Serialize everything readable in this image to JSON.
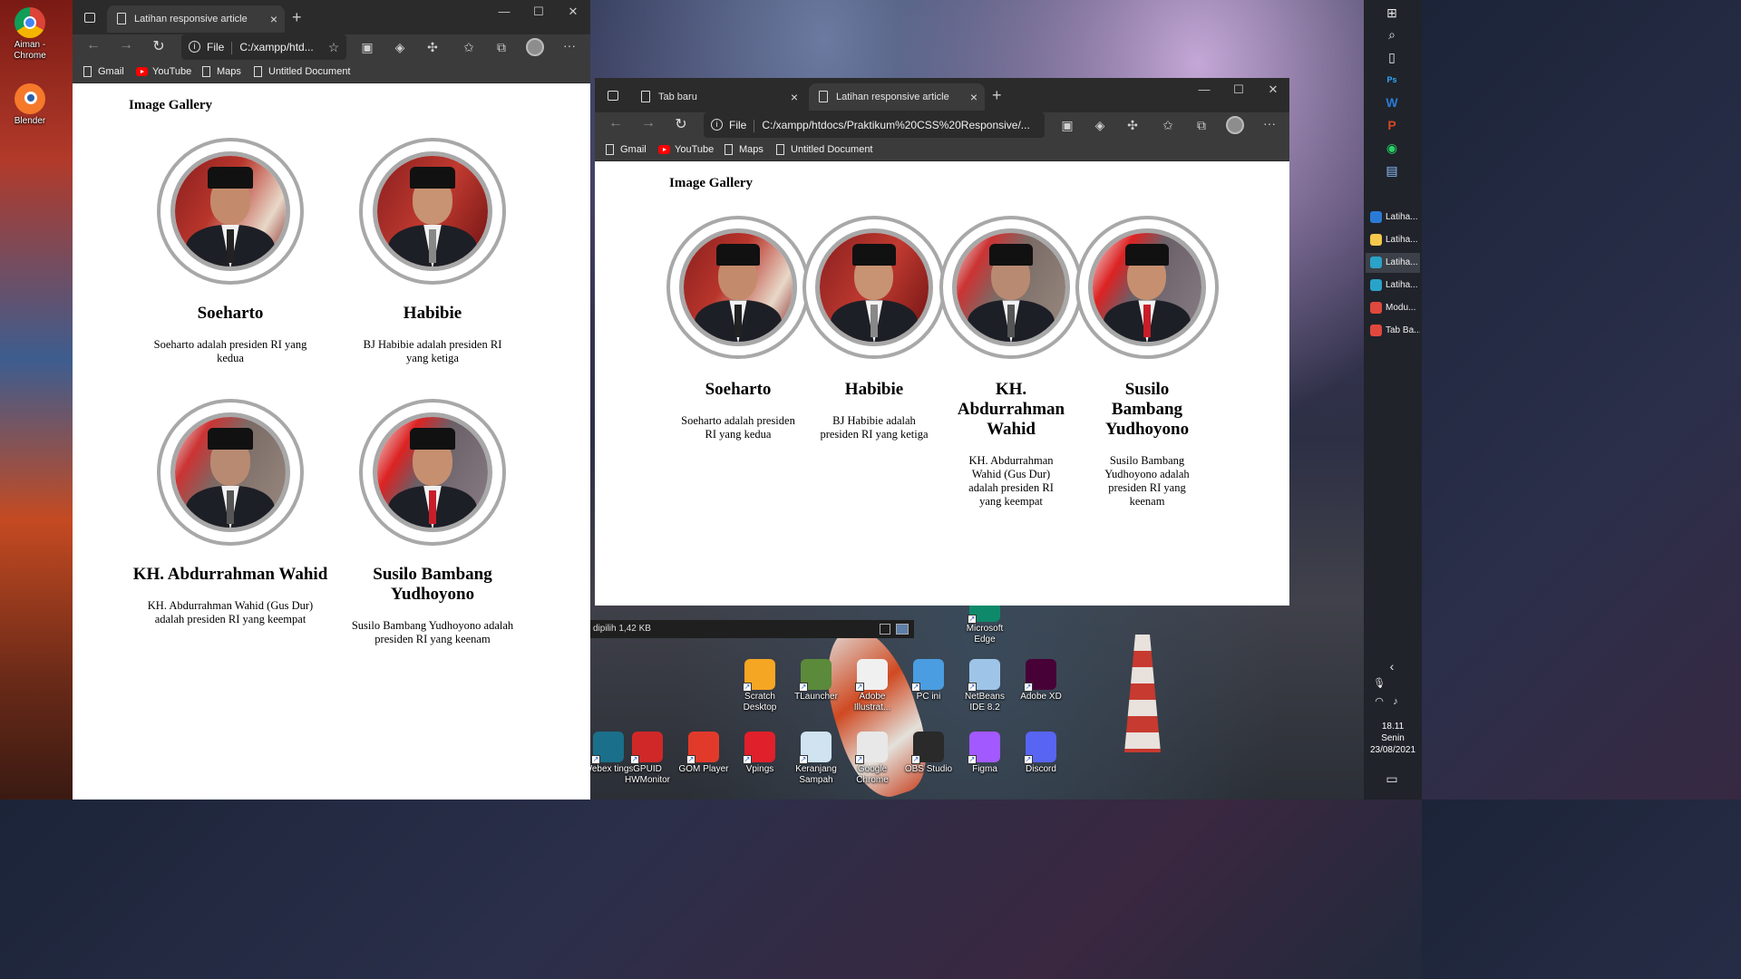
{
  "desktop_left": {
    "icons": [
      {
        "label": "Aiman - Chrome",
        "icon": "chrome-icon"
      },
      {
        "label": "Blender",
        "icon": "blender-icon"
      }
    ]
  },
  "desktop_right": {
    "icons": [
      {
        "label": "Microsoft Edge",
        "icon": "edge-icon"
      },
      {
        "label": "Scratch Desktop",
        "icon": "scratch-icon"
      },
      {
        "label": "TLauncher",
        "icon": "tlauncher-icon"
      },
      {
        "label": "Adobe Illustrat...",
        "icon": "illustrator-icon"
      },
      {
        "label": "PC ini",
        "icon": "pc-icon"
      },
      {
        "label": "NetBeans IDE 8.2",
        "icon": "netbeans-icon"
      },
      {
        "label": "Adobe XD",
        "icon": "xd-icon"
      },
      {
        "label": "Webex tings",
        "icon": "webex-icon"
      },
      {
        "label": "GPUID HWMonitor",
        "icon": "hwmonitor-icon"
      },
      {
        "label": "GOM Player",
        "icon": "gom-icon"
      },
      {
        "label": "Vpings",
        "icon": "vpings-icon"
      },
      {
        "label": "Keranjang Sampah",
        "icon": "recycle-bin-icon"
      },
      {
        "label": "Google Chrome",
        "icon": "chrome-icon"
      },
      {
        "label": "OBS Studio",
        "icon": "obs-icon"
      },
      {
        "label": "Figma",
        "icon": "figma-icon"
      },
      {
        "label": "Discord",
        "icon": "discord-icon"
      }
    ]
  },
  "explorer_status": {
    "text": "dipilih  1,42 KB"
  },
  "taskbar": {
    "tasks": [
      {
        "label": "Latiha...",
        "color": "#2b7bd6"
      },
      {
        "label": "Latiha...",
        "color": "#f3c84b"
      },
      {
        "label": "Latiha...",
        "color": "#2aa3c9"
      },
      {
        "label": "Latiha...",
        "color": "#2aa3c9"
      },
      {
        "label": "Modu...",
        "color": "#e0483d"
      },
      {
        "label": "Tab Ba...",
        "color": "#e0483d"
      }
    ],
    "clock_time": "18.11",
    "clock_day": "Senin",
    "clock_date": "23/08/2021"
  },
  "window1": {
    "tab_title": "Latihan responsive article",
    "address": "C:/xampp/htd...",
    "file_label": "File",
    "bookmarks": [
      "Gmail",
      "YouTube",
      "Maps",
      "Untitled Document"
    ],
    "page": {
      "title": "Image Gallery",
      "cards": [
        {
          "name": "Soeharto",
          "desc": "Soeharto adalah presiden RI yang kedua"
        },
        {
          "name": "Habibie",
          "desc": "BJ Habibie adalah presiden RI yang ketiga"
        },
        {
          "name": "KH. Abdurrahman Wahid",
          "desc": "KH. Abdurrahman Wahid (Gus Dur) adalah presiden RI yang keempat"
        },
        {
          "name": "Susilo Bambang Yudhoyono",
          "desc": "Susilo Bambang Yudhoyono adalah presiden RI yang keenam"
        }
      ]
    }
  },
  "window2": {
    "tabs": [
      "Tab baru",
      "Latihan responsive article"
    ],
    "address": "C:/xampp/htdocs/Praktikum%20CSS%20Responsive/...",
    "file_label": "File",
    "bookmarks": [
      "Gmail",
      "YouTube",
      "Maps",
      "Untitled Document"
    ],
    "page": {
      "title": "Image Gallery",
      "cards": [
        {
          "name": "Soeharto",
          "desc": "Soeharto adalah presiden RI yang kedua"
        },
        {
          "name": "Habibie",
          "desc": "BJ Habibie adalah presiden RI yang ketiga"
        },
        {
          "name": "KH. Abdurrahman Wahid",
          "desc": "KH. Abdurrahman Wahid (Gus Dur) adalah presiden RI yang keempat"
        },
        {
          "name": "Susilo Bambang Yudhoyono",
          "desc": "Susilo Bambang Yudhoyono adalah presiden RI yang keenam"
        }
      ]
    }
  },
  "colors": {
    "frame_border": "#a8a8a8",
    "chrome_dark": "#2b2b2b",
    "chrome_mid": "#3b3b3b"
  }
}
